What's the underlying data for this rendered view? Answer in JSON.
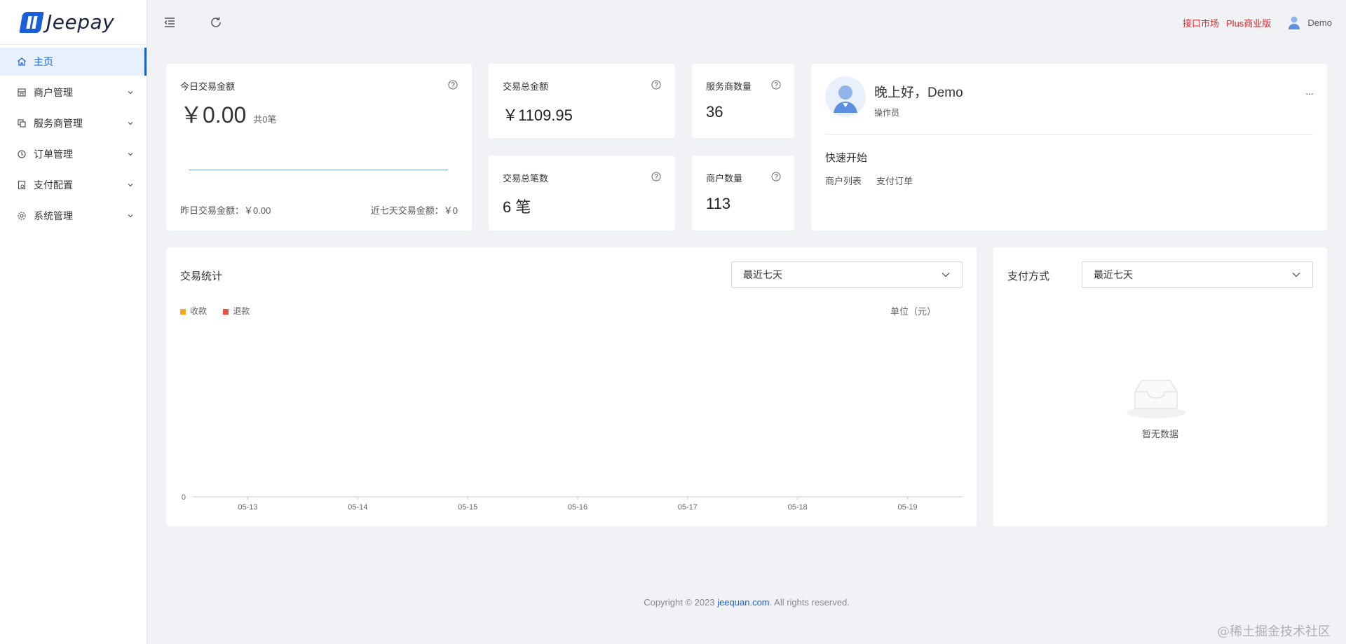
{
  "app": {
    "logo_text": "Jeepay"
  },
  "sidebar": {
    "items": [
      {
        "label": "主页",
        "icon": "home-icon",
        "active": true
      },
      {
        "label": "商户管理",
        "icon": "store-icon"
      },
      {
        "label": "服务商管理",
        "icon": "copy-icon"
      },
      {
        "label": "订单管理",
        "icon": "order-icon"
      },
      {
        "label": "支付配置",
        "icon": "config-icon"
      },
      {
        "label": "系统管理",
        "icon": "gear-icon"
      }
    ]
  },
  "header": {
    "link_market": "接口市场",
    "link_plus": "Plus商业版",
    "user_name": "Demo"
  },
  "today": {
    "label": "今日交易金额",
    "amount": "￥0.00",
    "count": "共0笔",
    "yesterday": "昨日交易金额：￥0.00",
    "week": "近七天交易金额：￥0"
  },
  "total_amount": {
    "label": "交易总金额",
    "value": "￥1109.95"
  },
  "total_count": {
    "label": "交易总笔数",
    "value": "6 笔"
  },
  "isv_count": {
    "label": "服务商数量",
    "value": "36"
  },
  "mch_count": {
    "label": "商户数量",
    "value": "113"
  },
  "welcome": {
    "greeting": "晚上好，Demo",
    "role": "操作员",
    "more": "···",
    "quick_title": "快速开始",
    "quick_links": [
      "商户列表",
      "支付订单"
    ]
  },
  "trade_stats": {
    "title": "交易统计",
    "range": "最近七天",
    "unit": "单位（元）",
    "legend": [
      {
        "name": "收款",
        "color": "#f5a623"
      },
      {
        "name": "退款",
        "color": "#e8553d"
      }
    ]
  },
  "chart_data": {
    "type": "bar",
    "categories": [
      "05-13",
      "05-14",
      "05-15",
      "05-16",
      "05-17",
      "05-18",
      "05-19"
    ],
    "series": [
      {
        "name": "收款",
        "values": [
          0,
          0,
          0,
          0,
          0,
          0,
          0
        ]
      },
      {
        "name": "退款",
        "values": [
          0,
          0,
          0,
          0,
          0,
          0,
          0
        ]
      }
    ],
    "y_tick": "0",
    "xlabel": "",
    "ylabel": ""
  },
  "pay_method": {
    "title": "支付方式",
    "range": "最近七天",
    "empty_text": "暂无数据"
  },
  "footer": {
    "prefix": "Copyright © 2023 ",
    "link": "jeequan.com",
    "suffix": ". All rights reserved."
  },
  "watermark": "@稀土掘金技术社区"
}
